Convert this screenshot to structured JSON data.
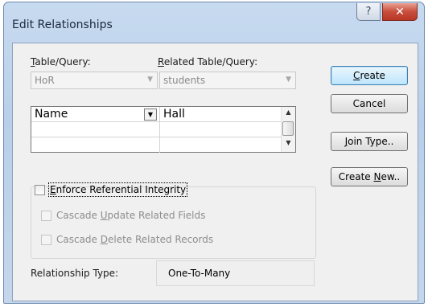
{
  "window": {
    "title": "Edit Relationships",
    "help_glyph": "?",
    "close_glyph": "✕"
  },
  "table_query": {
    "label_mnemonic": "T",
    "label_rest": "able/Query:",
    "value": "HoR"
  },
  "related_query": {
    "label_mnemonic": "R",
    "label_rest": "elated Table/Query:",
    "value": "students"
  },
  "grid": {
    "rows": [
      {
        "left": "Name",
        "right": "Hall"
      },
      {
        "left": "",
        "right": ""
      },
      {
        "left": "",
        "right": ""
      }
    ]
  },
  "buttons": {
    "create": {
      "mnemonic": "C",
      "rest": "reate"
    },
    "cancel": "Cancel",
    "join_type": {
      "mnemonic": "J",
      "rest": "oin Type.."
    },
    "create_new": {
      "pre": "Create ",
      "mnemonic": "N",
      "rest": "ew.."
    }
  },
  "integrity": {
    "enforce": {
      "mnemonic": "E",
      "rest": "nforce Referential Integrity",
      "checked": false
    },
    "cascade_update": {
      "pre": "Cascade ",
      "mnemonic": "U",
      "rest": "pdate Related Fields",
      "checked": false
    },
    "cascade_delete": {
      "pre": "Cascade ",
      "mnemonic": "D",
      "rest": "elete Related Records",
      "checked": false
    }
  },
  "relationship_type": {
    "label": "Relationship Type:",
    "value": "One-To-Many"
  }
}
